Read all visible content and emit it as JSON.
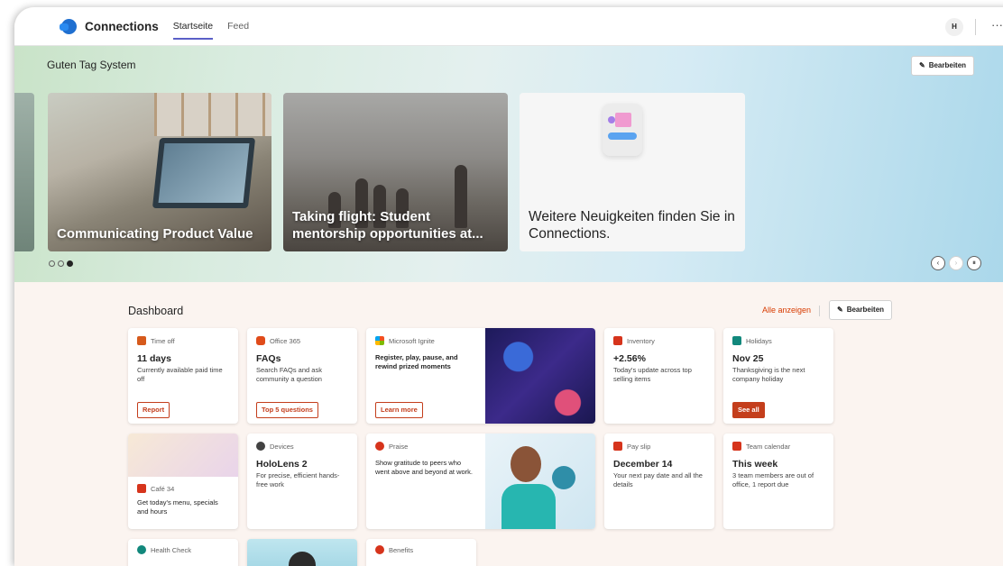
{
  "app": {
    "title": "Connections"
  },
  "tabs": [
    {
      "label": "Startseite",
      "active": true
    },
    {
      "label": "Feed",
      "active": false
    }
  ],
  "header": {
    "avatar": "H",
    "more": "···"
  },
  "hero": {
    "greeting": "Guten Tag System",
    "edit_label": "Bearbeiten",
    "news": [
      {
        "title": "Communicating Product Value"
      },
      {
        "title": "Taking flight: Student mentorship opportunities at..."
      },
      {
        "title": "Weitere Neuigkeiten finden Sie in Connections."
      }
    ],
    "carousel": {
      "current": 3,
      "total": 3
    }
  },
  "dashboard": {
    "title": "Dashboard",
    "see_all": "Alle anzeigen",
    "edit_label": "Bearbeiten",
    "cards": [
      {
        "app": "Time off",
        "big": "11 days",
        "sub": "Currently available paid time off",
        "button": "Report"
      },
      {
        "app": "Office 365",
        "big": "FAQs",
        "sub": "Search FAQs and ask community a question",
        "button": "Top 5 questions"
      },
      {
        "app": "Microsoft Ignite",
        "text": "Register, play, pause, and rewind prized moments",
        "button": "Learn more"
      },
      {
        "app": "Inventory",
        "big": "+2.56%",
        "sub": "Today's update across top selling items"
      },
      {
        "app": "Holidays",
        "big": "Nov 25",
        "sub": "Thanksgiving is the next company holiday",
        "button": "See all"
      },
      {
        "app": "Café 34",
        "text": "Get today's menu, specials and hours"
      },
      {
        "app": "Devices",
        "big": "HoloLens 2",
        "sub": "For precise, efficient hands-free work"
      },
      {
        "app": "Praise",
        "text": "Show gratitude to peers who went above and beyond at work."
      },
      {
        "app": "Pay slip",
        "big": "December 14",
        "sub": "Your next pay date and all the details"
      },
      {
        "app": "Team calendar",
        "big": "This week",
        "sub": "3 team members are out of office, 1 report due"
      },
      {
        "app": "Health Check"
      },
      {
        "app": "Benefits"
      }
    ]
  },
  "colors": {
    "accent": "#c43e1c",
    "tab_underline": "#5b5fc7",
    "see_all": "#d83b01"
  }
}
